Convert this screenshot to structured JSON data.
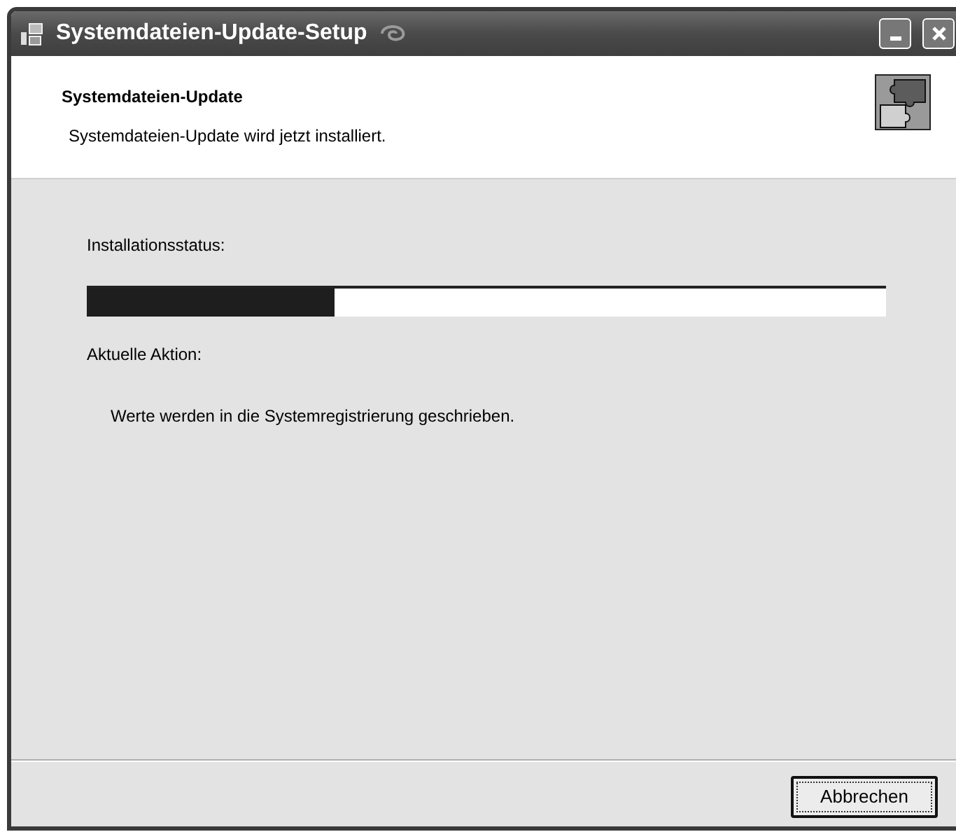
{
  "window": {
    "title": "Systemdateien-Update-Setup"
  },
  "header": {
    "title": "Systemdateien-Update",
    "subtitle": "Systemdateien-Update wird jetzt installiert."
  },
  "status_label": "Installationsstatus:",
  "progress": {
    "level": 0.31
  },
  "action_label": "Aktuelle Aktion:",
  "action_text": "Werte werden in die Systemregistrierung geschrieben.",
  "buttons": [
    {
      "label": "Abbrechen",
      "focused": true
    }
  ]
}
